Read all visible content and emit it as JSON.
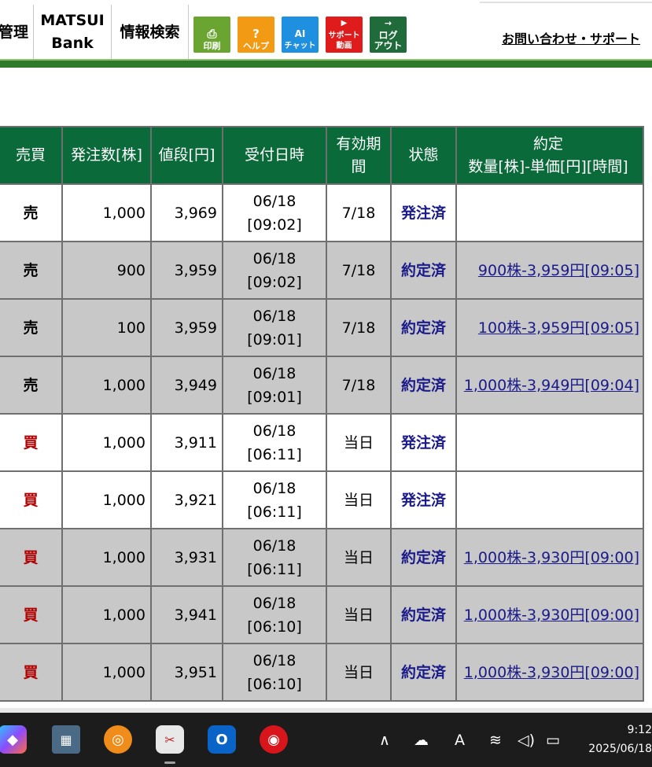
{
  "nav": {
    "manage": "管理",
    "bank_line1": "MATSUI",
    "bank_line2": "Bank",
    "info_search": "情報検索",
    "print_label": "印刷",
    "help_label": "ヘルプ",
    "ai_line1": "AI",
    "ai_line2": "チャット",
    "video_line1": "サポート",
    "video_line2": "動画",
    "logout_line1": "ログ",
    "logout_line2": "アウト",
    "support": "お問い合わせ・サポート"
  },
  "colors": {
    "nav_green": "#2f7a2a",
    "header_green": "#0a6a3a",
    "buy_red": "#b00000",
    "status_blue": "#1a1a8a"
  },
  "table": {
    "headers": {
      "side": "売買",
      "qty": "発注数[株]",
      "price": "値段[円]",
      "date": "受付日時",
      "exp_line1": "有効期",
      "exp_line2": "間",
      "state": "状態",
      "fill_line1": "約定",
      "fill_line2": "数量[株]-単価[円][時間]"
    },
    "rows": [
      {
        "side": "売",
        "qty": "1,000",
        "price": "3,969",
        "date": "06/18",
        "time": "[09:02]",
        "exp": "7/18",
        "state": "発注済",
        "fill": ""
      },
      {
        "side": "売",
        "qty": "900",
        "price": "3,959",
        "date": "06/18",
        "time": "[09:02]",
        "exp": "7/18",
        "state": "約定済",
        "fill": "900株-3,959円[09:05]"
      },
      {
        "side": "売",
        "qty": "100",
        "price": "3,959",
        "date": "06/18",
        "time": "[09:01]",
        "exp": "7/18",
        "state": "約定済",
        "fill": "100株-3,959円[09:05]"
      },
      {
        "side": "売",
        "qty": "1,000",
        "price": "3,949",
        "date": "06/18",
        "time": "[09:01]",
        "exp": "7/18",
        "state": "約定済",
        "fill": "1,000株-3,949円[09:04]"
      },
      {
        "side": "買",
        "qty": "1,000",
        "price": "3,911",
        "date": "06/18",
        "time": "[06:11]",
        "exp": "当日",
        "state": "発注済",
        "fill": ""
      },
      {
        "side": "買",
        "qty": "1,000",
        "price": "3,921",
        "date": "06/18",
        "time": "[06:11]",
        "exp": "当日",
        "state": "発注済",
        "fill": ""
      },
      {
        "side": "買",
        "qty": "1,000",
        "price": "3,931",
        "date": "06/18",
        "time": "[06:11]",
        "exp": "当日",
        "state": "約定済",
        "fill": "1,000株-3,930円[09:00]"
      },
      {
        "side": "買",
        "qty": "1,000",
        "price": "3,941",
        "date": "06/18",
        "time": "[06:10]",
        "exp": "当日",
        "state": "約定済",
        "fill": "1,000株-3,930円[09:00]"
      },
      {
        "side": "買",
        "qty": "1,000",
        "price": "3,951",
        "date": "06/18",
        "time": "[06:10]",
        "exp": "当日",
        "state": "約定済",
        "fill": "1,000株-3,930円[09:00]"
      }
    ]
  },
  "taskbar": {
    "clock_time": "9:12",
    "clock_date": "2025/06/18",
    "ime_indicator": "A"
  }
}
